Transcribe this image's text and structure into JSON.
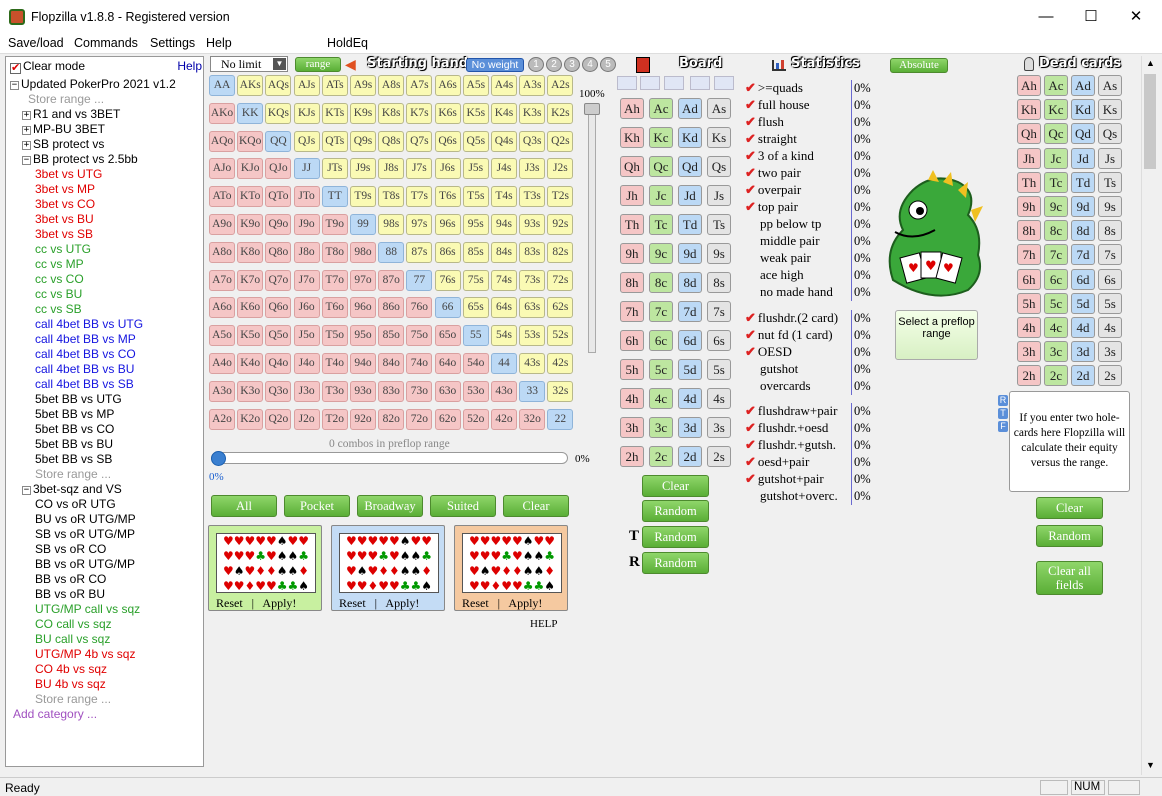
{
  "window": {
    "title": "Flopzilla v1.8.8 - Registered version",
    "minimize": "—",
    "maximize": "☐",
    "close": "✕"
  },
  "menu": [
    "Save/load",
    "Commands",
    "Settings",
    "Help",
    "HoldEq"
  ],
  "left": {
    "clear_mode": "Clear mode",
    "help": "Help",
    "tree": [
      {
        "t": "Updated PokerPro 2021 v1.2",
        "box": "−",
        "x": 4,
        "c": "#000"
      },
      {
        "t": "Store range ...",
        "x": 22,
        "c": "#999"
      },
      {
        "t": "R1 and vs 3BET",
        "box": "+",
        "x": 16,
        "c": "#000"
      },
      {
        "t": "MP-BU 3BET",
        "box": "+",
        "x": 16,
        "c": "#000"
      },
      {
        "t": "SB protect vs",
        "box": "+",
        "x": 16,
        "c": "#000"
      },
      {
        "t": "BB protect vs 2.5bb",
        "box": "−",
        "x": 16,
        "c": "#000"
      },
      {
        "t": "3bet vs UTG",
        "x": 29,
        "c": "#e00000"
      },
      {
        "t": "3bet vs MP",
        "x": 29,
        "c": "#e00000"
      },
      {
        "t": "3bet vs CO",
        "x": 29,
        "c": "#e00000"
      },
      {
        "t": "3bet vs BU",
        "x": 29,
        "c": "#e00000"
      },
      {
        "t": "3bet vs SB",
        "x": 29,
        "c": "#e00000"
      },
      {
        "t": "cc vs UTG",
        "x": 29,
        "c": "#2aa02a"
      },
      {
        "t": "cc vs MP",
        "x": 29,
        "c": "#2aa02a"
      },
      {
        "t": "cc vs CO",
        "x": 29,
        "c": "#2aa02a"
      },
      {
        "t": "cc vs BU",
        "x": 29,
        "c": "#2aa02a"
      },
      {
        "t": "cc vs SB",
        "x": 29,
        "c": "#2aa02a"
      },
      {
        "t": "call 4bet BB vs UTG",
        "x": 29,
        "c": "#1515e0"
      },
      {
        "t": "call 4bet BB vs MP",
        "x": 29,
        "c": "#1515e0"
      },
      {
        "t": "call 4bet BB vs CO",
        "x": 29,
        "c": "#1515e0"
      },
      {
        "t": "call 4bet BB vs BU",
        "x": 29,
        "c": "#1515e0"
      },
      {
        "t": "call 4bet BB vs SB",
        "x": 29,
        "c": "#1515e0"
      },
      {
        "t": "5bet BB vs UTG",
        "x": 29,
        "c": "#000"
      },
      {
        "t": "5bet BB vs MP",
        "x": 29,
        "c": "#000"
      },
      {
        "t": "5bet BB vs CO",
        "x": 29,
        "c": "#000"
      },
      {
        "t": "5bet BB vs BU",
        "x": 29,
        "c": "#000"
      },
      {
        "t": "5bet BB vs SB",
        "x": 29,
        "c": "#000"
      },
      {
        "t": "Store range ...",
        "x": 29,
        "c": "#999"
      },
      {
        "t": "3bet-sqz and VS",
        "box": "−",
        "x": 16,
        "c": "#000"
      },
      {
        "t": "CO vs oR UTG",
        "x": 29,
        "c": "#000"
      },
      {
        "t": "BU vs oR UTG/MP",
        "x": 29,
        "c": "#000"
      },
      {
        "t": "SB vs oR UTG/MP",
        "x": 29,
        "c": "#000"
      },
      {
        "t": "SB vs oR CO",
        "x": 29,
        "c": "#000"
      },
      {
        "t": "BB vs oR UTG/MP",
        "x": 29,
        "c": "#000"
      },
      {
        "t": "BB vs oR CO",
        "x": 29,
        "c": "#000"
      },
      {
        "t": "BB vs oR BU",
        "x": 29,
        "c": "#000"
      },
      {
        "t": "UTG/MP call vs sqz",
        "x": 29,
        "c": "#2aa02a"
      },
      {
        "t": "CO call vs sqz",
        "x": 29,
        "c": "#2aa02a"
      },
      {
        "t": "BU call vs sqz",
        "x": 29,
        "c": "#2aa02a"
      },
      {
        "t": "UTG/MP 4b vs sqz",
        "x": 29,
        "c": "#e00000"
      },
      {
        "t": "CO 4b vs sqz",
        "x": 29,
        "c": "#e00000"
      },
      {
        "t": "BU 4b vs sqz",
        "x": 29,
        "c": "#e00000"
      },
      {
        "t": "Store range ...",
        "x": 29,
        "c": "#999"
      },
      {
        "t": "Add category ...",
        "x": 7,
        "c": "#a050c0"
      }
    ]
  },
  "range": {
    "limit_select": "No limit",
    "range_btn": "range",
    "title": "Starting hand",
    "weight_btn": "No weight",
    "weights": [
      "1",
      "2",
      "3",
      "4",
      "5"
    ],
    "ranks": [
      "A",
      "K",
      "Q",
      "J",
      "T",
      "9",
      "8",
      "7",
      "6",
      "5",
      "4",
      "3",
      "2"
    ],
    "slider_max": "100%",
    "combos": "0 combos in preflop range",
    "progress_value": "0%",
    "progress_left": "0%",
    "buttons": [
      "All",
      "Pocket",
      "Broadway",
      "Suited",
      "Clear"
    ],
    "presets": [
      {
        "bg": "#c8f0a0",
        "reset": "Reset",
        "apply": "Apply!"
      },
      {
        "bg": "#c4dcf5",
        "reset": "Reset",
        "apply": "Apply!"
      },
      {
        "bg": "#f5c9a0",
        "reset": "Reset",
        "apply": "Apply!"
      }
    ],
    "help": "HELP"
  },
  "board": {
    "title": "Board",
    "rows": [
      "A",
      "K",
      "Q",
      "J",
      "T",
      "9",
      "8",
      "7",
      "6",
      "5",
      "4",
      "3",
      "2"
    ],
    "suits": [
      "h",
      "c",
      "d",
      "s"
    ],
    "clear": "Clear",
    "random": "Random",
    "t_label": "T",
    "t_random": "Random",
    "r_label": "R",
    "r_random": "Random"
  },
  "stats": {
    "title": "Statistics",
    "absolute_btn": "Absolute",
    "group1": [
      {
        "label": ">=quads",
        "check": true,
        "val": "0%"
      },
      {
        "label": "full house",
        "check": true,
        "val": "0%"
      },
      {
        "label": "flush",
        "check": true,
        "val": "0%"
      },
      {
        "label": "straight",
        "check": true,
        "val": "0%"
      },
      {
        "label": "3 of a kind",
        "check": true,
        "val": "0%"
      },
      {
        "label": "two pair",
        "check": true,
        "val": "0%"
      },
      {
        "label": "overpair",
        "check": true,
        "val": "0%"
      },
      {
        "label": "top pair",
        "check": true,
        "val": "0%"
      },
      {
        "label": "pp below tp",
        "check": false,
        "val": "0%"
      },
      {
        "label": "middle pair",
        "check": false,
        "val": "0%"
      },
      {
        "label": "weak pair",
        "check": false,
        "val": "0%"
      },
      {
        "label": "ace high",
        "check": false,
        "val": "0%"
      },
      {
        "label": "no made hand",
        "check": false,
        "val": "0%"
      }
    ],
    "group2": [
      {
        "label": "flushdr.(2 card)",
        "check": true,
        "val": "0%"
      },
      {
        "label": "nut fd (1 card)",
        "check": true,
        "val": "0%"
      },
      {
        "label": "OESD",
        "check": true,
        "val": "0%"
      },
      {
        "label": "gutshot",
        "check": false,
        "val": "0%"
      },
      {
        "label": "overcards",
        "check": false,
        "val": "0%"
      }
    ],
    "group3": [
      {
        "label": "flushdraw+pair",
        "check": true,
        "val": "0%"
      },
      {
        "label": "flushdr.+oesd",
        "check": true,
        "val": "0%"
      },
      {
        "label": "flushdr.+gutsh.",
        "check": true,
        "val": "0%"
      },
      {
        "label": "oesd+pair",
        "check": true,
        "val": "0%"
      },
      {
        "label": "gutshot+pair",
        "check": true,
        "val": "0%"
      },
      {
        "label": "gutshot+overc.",
        "check": false,
        "val": "0%"
      }
    ],
    "select_preflop": "Select a preflop range"
  },
  "dead": {
    "title": "Dead cards",
    "rtf": [
      "R",
      "T",
      "F"
    ],
    "equity_note": "If you enter two hole-cards here Flopzilla will calculate their equity versus the range.",
    "clear": "Clear",
    "random": "Random",
    "clear_all": "Clear all fields"
  },
  "status": {
    "text": "Ready",
    "num": "NUM"
  }
}
